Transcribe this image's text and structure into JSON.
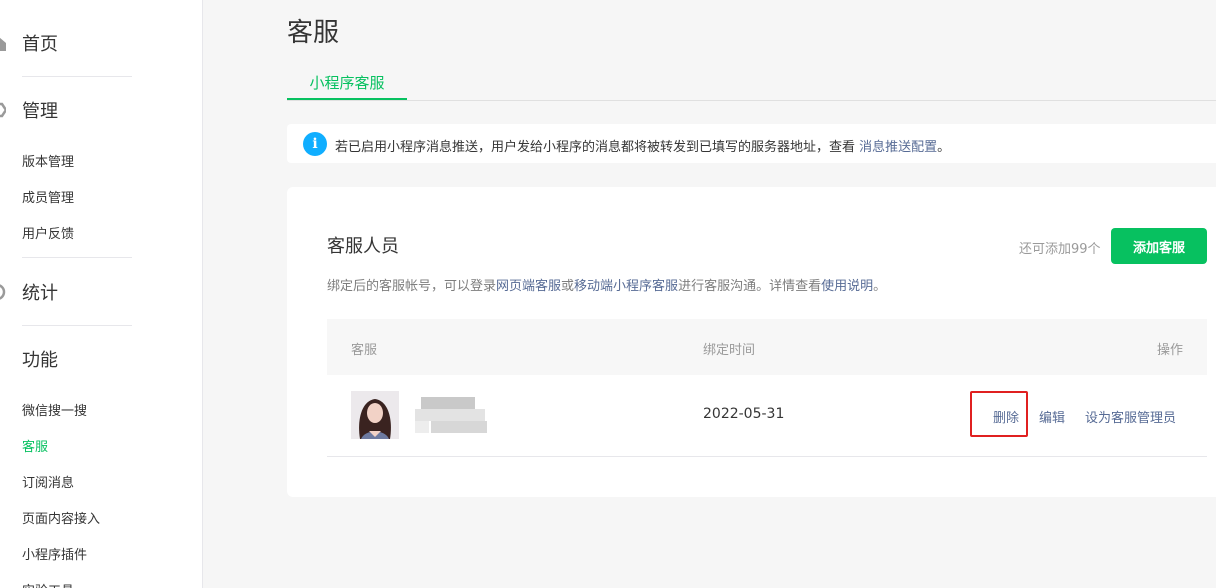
{
  "sidebar": {
    "cat_home": "首页",
    "cat_manage": "管理",
    "manage_items": [
      "版本管理",
      "成员管理",
      "用户反馈"
    ],
    "cat_stats": "统计",
    "cat_features": "功能",
    "feature_items": [
      "微信搜一搜",
      "客服",
      "订阅消息",
      "页面内容接入",
      "小程序插件",
      "实验工具"
    ],
    "active_item": "客服"
  },
  "page": {
    "title": "客服",
    "tab": "小程序客服"
  },
  "notice": {
    "text": "若已启用小程序消息推送，用户发给小程序的消息都将被转发到已填写的服务器地址，查看 ",
    "link": "消息推送配置",
    "end": "。"
  },
  "section": {
    "title": "客服人员",
    "quota": "还可添加99个",
    "add_button": "添加客服",
    "desc_1": "绑定后的客服帐号，可以登录",
    "desc_link_1": "网页端客服",
    "desc_2": "或",
    "desc_link_2": "移动端小程序客服",
    "desc_3": "进行客服沟通。详情查看",
    "desc_link_3": "使用说明",
    "desc_4": "。"
  },
  "table": {
    "columns": [
      "客服",
      "绑定时间",
      "操作"
    ],
    "rows": [
      {
        "bound_time": "2022-05-31",
        "actions": [
          "删除",
          "编辑",
          "设为客服管理员"
        ]
      }
    ]
  },
  "colors": {
    "brand_green": "#07c160",
    "link_blue": "#576b95",
    "info_blue": "#10aeff",
    "highlight_red": "#e02020"
  }
}
